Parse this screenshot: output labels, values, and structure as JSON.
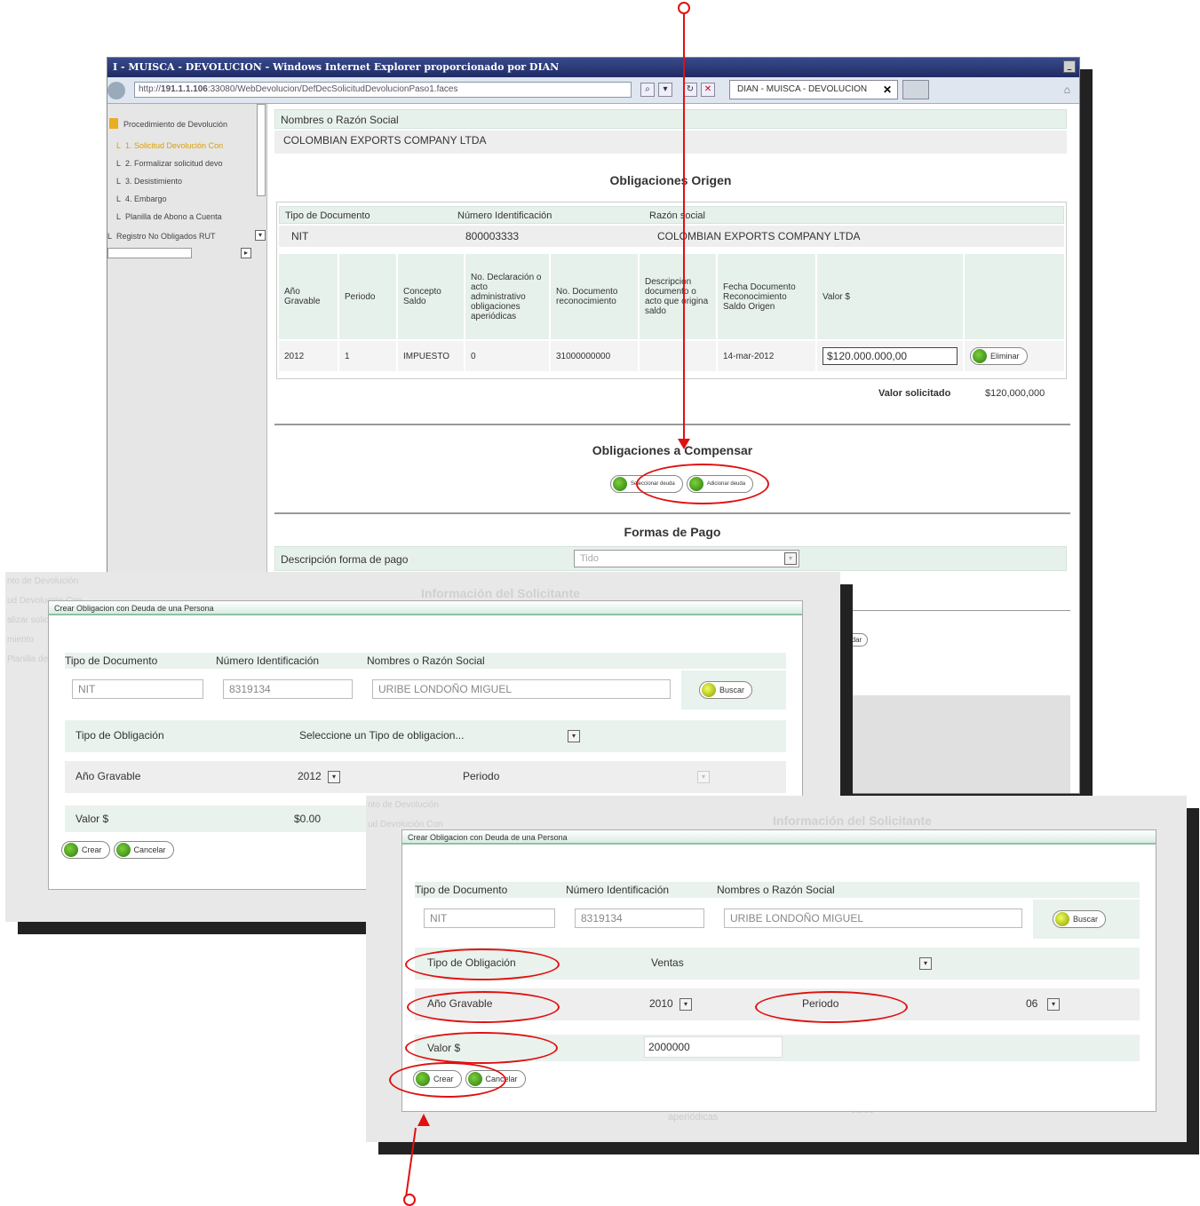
{
  "browser": {
    "title": "I - MUISCA - DEVOLUCION - Windows Internet Explorer proporcionado por DIAN",
    "url_prefix": "http://",
    "url_host": "191.1.1.106",
    "url_path": ":33080/WebDevolucion/DefDecSolicitudDevolucionPaso1.faces",
    "tab_label": "DIAN - MUISCA - DEVOLUCION",
    "tab_close": "✕"
  },
  "sidebar": {
    "root": "Procedimiento de Devolución",
    "items": [
      {
        "label": "1. Solicitud Devolución Con",
        "selected": true
      },
      {
        "label": "2. Formalizar solicitud devo",
        "selected": false
      },
      {
        "label": "3. Desistimiento",
        "selected": false
      },
      {
        "label": "4. Embargo",
        "selected": false
      },
      {
        "label": "Planilla de Abono a Cuenta",
        "selected": false
      },
      {
        "label": "Registro No Obligados RUT",
        "selected": false
      }
    ]
  },
  "main": {
    "nombres_label": "Nombres o Razón Social",
    "nombres_value": "COLOMBIAN EXPORTS COMPANY LTDA",
    "origen_title": "Obligaciones Origen",
    "origen_headers": {
      "tipo_doc": "Tipo de Documento",
      "num_id": "Número Identificación",
      "razon": "Razón social"
    },
    "origen_values": {
      "tipo_doc": "NIT",
      "num_id": "800003333",
      "razon": "COLOMBIAN EXPORTS COMPANY LTDA"
    },
    "table_headers": [
      "Año Gravable",
      "Periodo",
      "Concepto Saldo",
      "No. Declaración o acto administrativo obligaciones aperiódicas",
      "No. Documento reconocimiento",
      "Descripción documento o acto que origina saldo",
      "Fecha Documento Reconocimiento Saldo Origen",
      "Valor $",
      ""
    ],
    "table_row": [
      "2012",
      "1",
      "IMPUESTO",
      "0",
      "31000000000",
      "",
      "14-mar-2012"
    ],
    "valor_input": "$120.000.000,00",
    "eliminar": "Eliminar",
    "valor_solicitado_label": "Valor solicitado",
    "valor_solicitado_value": "$120,000,000",
    "compensar_title": "Obligaciones a Compensar",
    "btn_seleccionar": "Seleccionar deuda",
    "btn_adicionar": "Adicionar deuda",
    "formas_title": "Formas de Pago",
    "forma_label": "Descripción forma de pago",
    "forma_value": "Tido",
    "info_solicitante": "Información del Solicitante",
    "partial_btn": "rdar"
  },
  "dialog1": {
    "title": "Crear Obligacion con Deuda de una Persona",
    "h_tipo": "Tipo de Documento",
    "h_num": "Número Identificación",
    "h_nombres": "Nombres o Razón Social",
    "v_tipo": "NIT",
    "v_num": "8319134",
    "v_nombres": "URIBE LONDOÑO MIGUEL",
    "buscar": "Buscar",
    "tipo_obl_label": "Tipo de Obligación",
    "tipo_obl_value": "Seleccione un Tipo de obligacion...",
    "anio_label": "Año Gravable",
    "anio_value": "2012",
    "periodo_label": "Periodo",
    "valor_label": "Valor $",
    "valor_value": "$0.00",
    "crear": "Crear",
    "cancelar": "Cancelar",
    "bg_left_text": [
      "nto de Devolución",
      "ud Devolución Con",
      "alizar solic",
      "miento",
      "Planilla de Ab"
    ]
  },
  "dialog2": {
    "title": "Crear Obligacion con Deuda de una Persona",
    "h_tipo": "Tipo de Documento",
    "h_num": "Número Identificación",
    "h_nombres": "Nombres o Razón Social",
    "v_tipo": "NIT",
    "v_num": "8319134",
    "v_nombres": "URIBE LONDOÑO MIGUEL",
    "buscar": "Buscar",
    "tipo_obl_label": "Tipo de Obligación",
    "tipo_obl_value": "Ventas",
    "anio_label": "Año Gravable",
    "anio_value": "2010",
    "periodo_label": "Periodo",
    "periodo_value": "06",
    "valor_label": "Valor $",
    "valor_value": "2000000",
    "crear": "Crear",
    "cancelar": "Cancelar",
    "bg_info": "Información del Solicitante",
    "bg_left_text": [
      "nto de Devolución",
      "ud Devolución Con"
    ],
    "bg_bottom": "aperiódicas",
    "bg_bottom2": "saldo"
  },
  "colors": {
    "annotation_red": "#e01010",
    "header_green": "#e7f1ec",
    "titlebar_blue": "#1f2b66"
  }
}
